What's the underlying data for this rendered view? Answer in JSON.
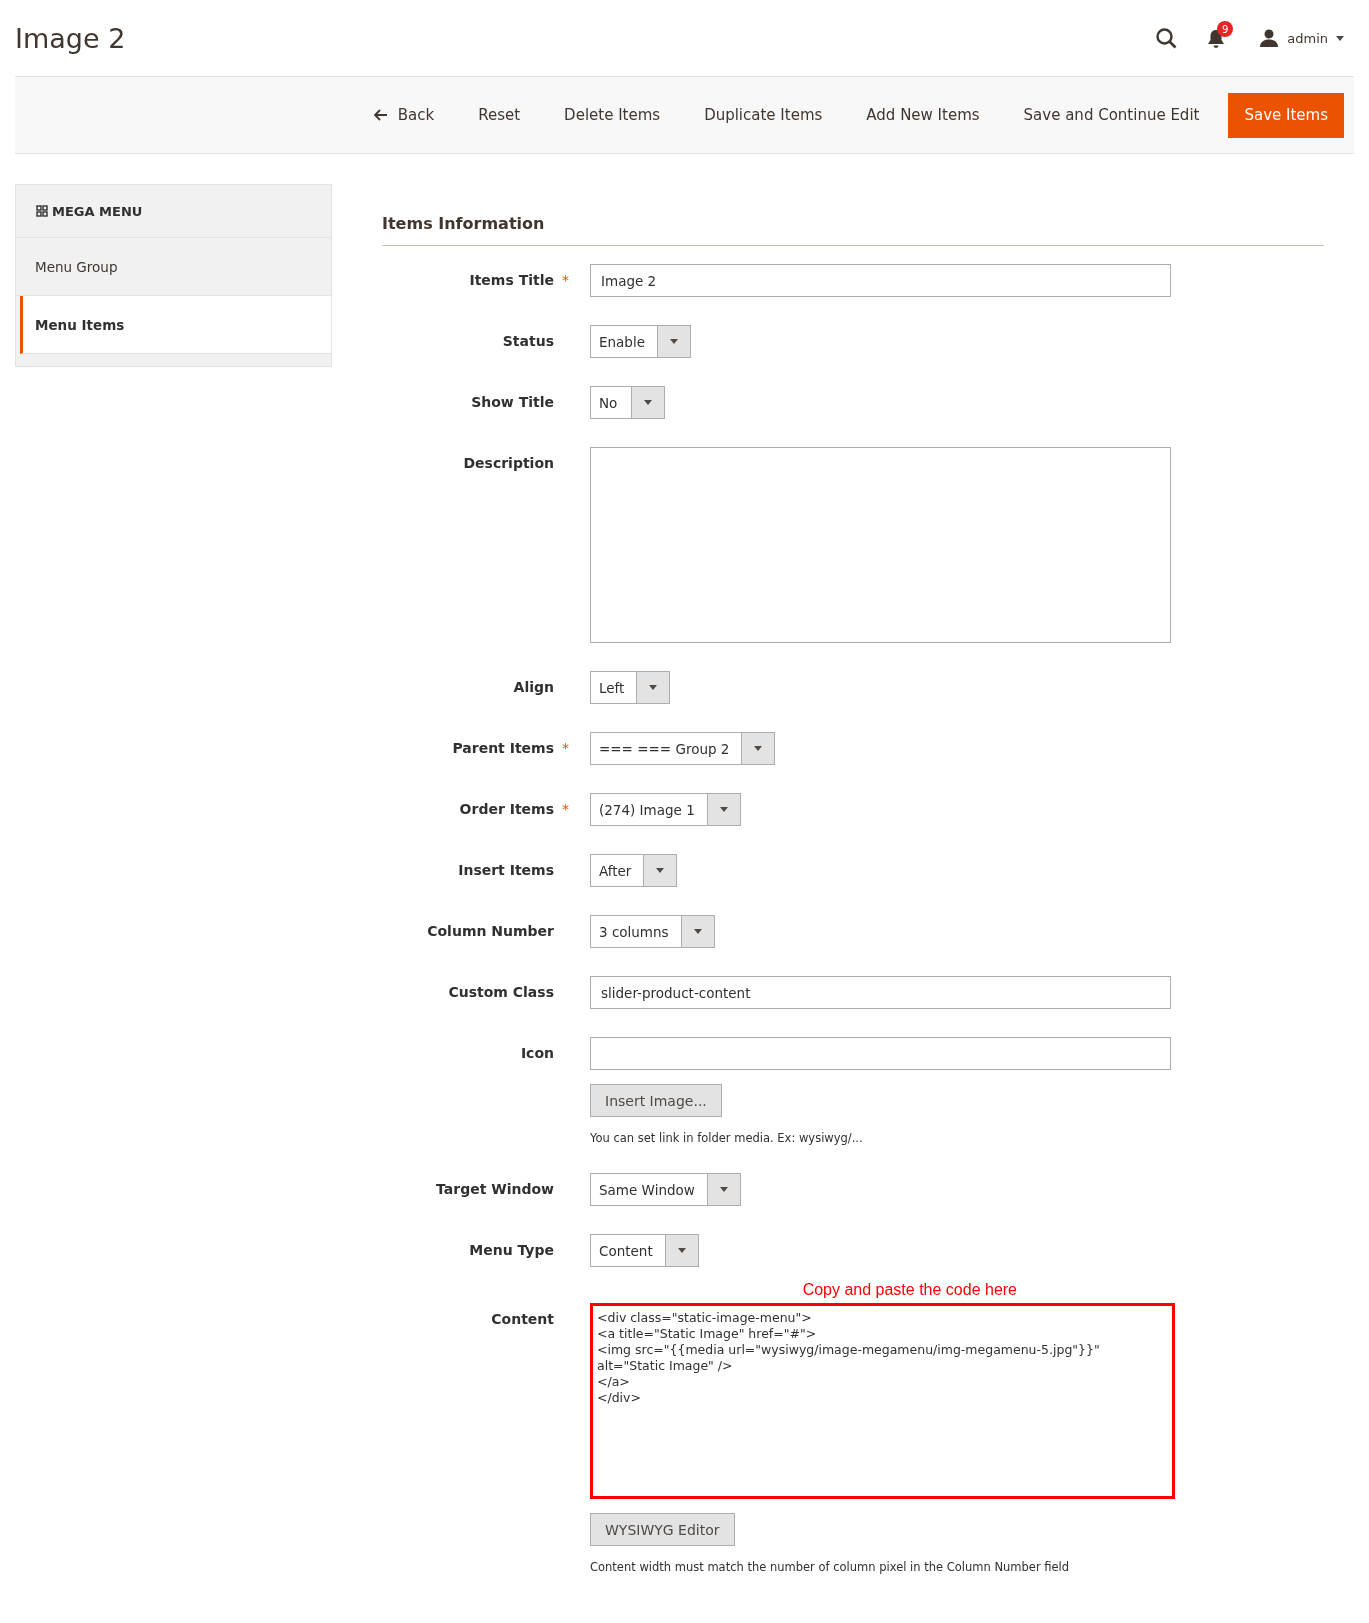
{
  "page_title": "Image 2",
  "header": {
    "notification_count": "9",
    "user": "admin"
  },
  "toolbar": {
    "buttons": [
      {
        "label": "Back",
        "kind": "back"
      },
      {
        "label": "Reset",
        "kind": "plain"
      },
      {
        "label": "Delete Items",
        "kind": "plain"
      },
      {
        "label": "Duplicate Items",
        "kind": "plain"
      },
      {
        "label": "Add New Items",
        "kind": "plain"
      },
      {
        "label": "Save and Continue Edit",
        "kind": "plain"
      },
      {
        "label": "Save Items",
        "kind": "primary"
      }
    ]
  },
  "sidebar": {
    "title": "MEGA MENU",
    "items": [
      {
        "label": "Menu Group",
        "selected": false
      },
      {
        "label": "Menu Items",
        "selected": true
      }
    ]
  },
  "section_title": "Items Information",
  "fields": [
    {
      "label": "Items Title",
      "kind": "text",
      "required_mark": "*",
      "value": "Image 2"
    },
    {
      "label": "Status",
      "kind": "select",
      "value": "Enable"
    },
    {
      "label": "Show Title",
      "kind": "select",
      "value": "No"
    },
    {
      "label": "Description",
      "kind": "textarea"
    },
    {
      "label": "Align",
      "kind": "select",
      "value": "Left"
    },
    {
      "label": "Parent Items",
      "kind": "select",
      "required_mark": "*",
      "value": "=== === Group 2"
    },
    {
      "label": "Order Items",
      "kind": "select",
      "required_mark": "*",
      "value": "(274) Image 1"
    },
    {
      "label": "Insert Items",
      "kind": "select",
      "value": "After"
    },
    {
      "label": "Column Number",
      "kind": "select",
      "value": "3 columns"
    },
    {
      "label": "Custom Class",
      "kind": "text",
      "value": "slider-product-content"
    },
    {
      "label": "Icon",
      "kind": "text",
      "button": "Insert Image...",
      "note": "You can set link in folder media. Ex: wysiwyg/..."
    },
    {
      "label": "Target Window",
      "kind": "select",
      "value": "Same Window"
    },
    {
      "label": "Menu Type",
      "kind": "select",
      "value": "Content"
    },
    {
      "label": "Content",
      "kind": "textarea",
      "highlighted": true,
      "annotation": "Copy and paste the code here",
      "value": "<div class=\"static-image-menu\">\n<a title=\"Static Image\" href=\"#\">\n<img src=\"{{media url=\"wysiwyg/image-megamenu/img-megamenu-5.jpg\"}}\"\nalt=\"Static Image\" />\n</a>\n</div>",
      "button": "WYSIWYG Editor",
      "note": "Content width must match the number of column pixel in the Column Number field"
    }
  ]
}
